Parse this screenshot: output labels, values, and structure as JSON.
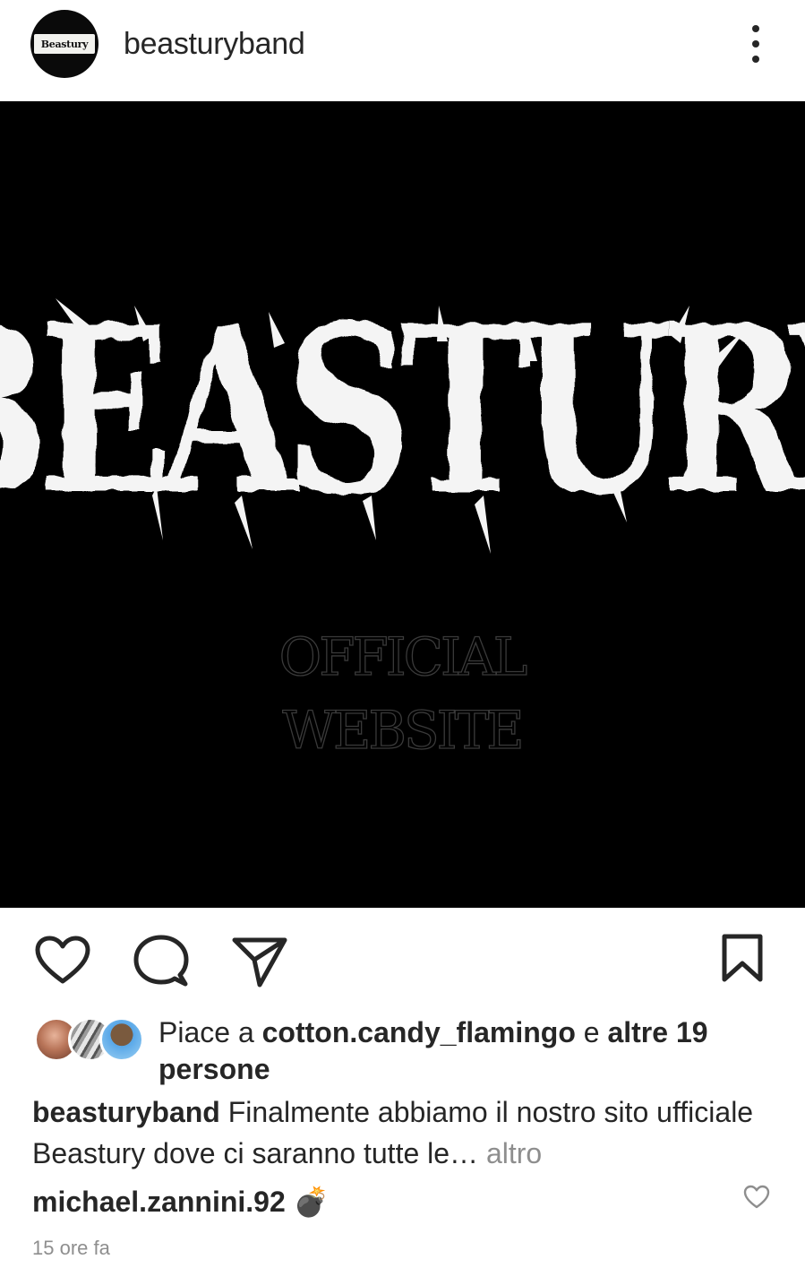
{
  "header": {
    "username": "beasturyband",
    "avatar_text": "Beastury"
  },
  "post_image": {
    "logo_text": "BEASTURY",
    "subtitle_line1": "OFFICIAL",
    "subtitle_line2": "WEBSITE"
  },
  "actions": {
    "like_icon": "heart-icon",
    "comment_icon": "comment-icon",
    "share_icon": "paper-plane-icon",
    "save_icon": "bookmark-icon"
  },
  "likes": {
    "prefix": "Piace a ",
    "liker": "cotton.candy_flamingo",
    "middle": " e ",
    "others": "altre 19 persone"
  },
  "caption": {
    "username": "beasturyband",
    "text": "Finalmente abbiamo il nostro sito ufficiale Beastury dove ci saranno tutte le…",
    "more_label": "altro"
  },
  "comment": {
    "username": "michael.zannini.92",
    "text": "💣"
  },
  "timestamp": "15 ore fa",
  "colors": {
    "text": "#262626",
    "muted": "#8e8e8e",
    "image_bg": "#000000"
  }
}
